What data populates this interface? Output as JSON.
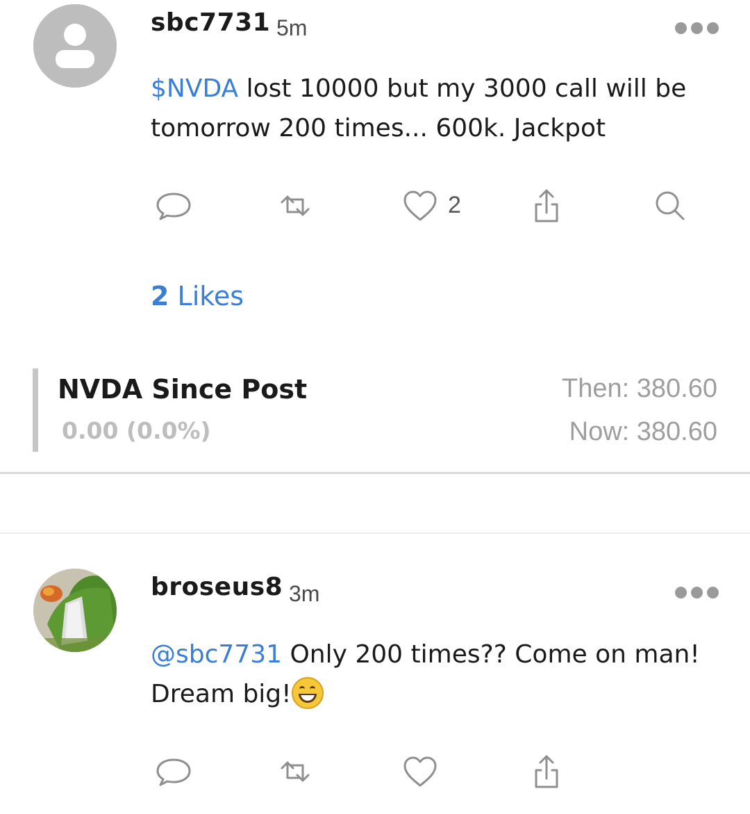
{
  "posts": [
    {
      "username": "sbc7731",
      "time": "5m",
      "avatar": "default-user-avatar",
      "body": {
        "link": "$NVDA",
        "text": " lost 10000 but my 3000 call will be tomorrow 200 times... 600k. Jackpot"
      },
      "like_count": "2",
      "likes_summary": {
        "count": "2",
        "label": " Likes"
      },
      "stock": {
        "title": "NVDA Since Post",
        "change": "0.00 (0.0%)",
        "then": "Then: 380.60",
        "now": "Now: 380.60"
      }
    },
    {
      "username": "broseus8",
      "time": "3m",
      "avatar": "kermit-photo-avatar",
      "body": {
        "link": "@sbc7731",
        "text": " Only 200 times?? Come on man! Dream big!",
        "emoji": "grinning-face-emoji"
      }
    }
  ],
  "icons": {
    "reply": "speech-bubble-icon",
    "reshare": "repost-arrows-icon",
    "like": "heart-icon",
    "share": "share-upload-icon",
    "search": "search-icon",
    "more": "more-dots-icon"
  },
  "colors": {
    "link": "#3a7fd5",
    "icon": "#8f8f8f",
    "muted": "#9e9e9e"
  }
}
